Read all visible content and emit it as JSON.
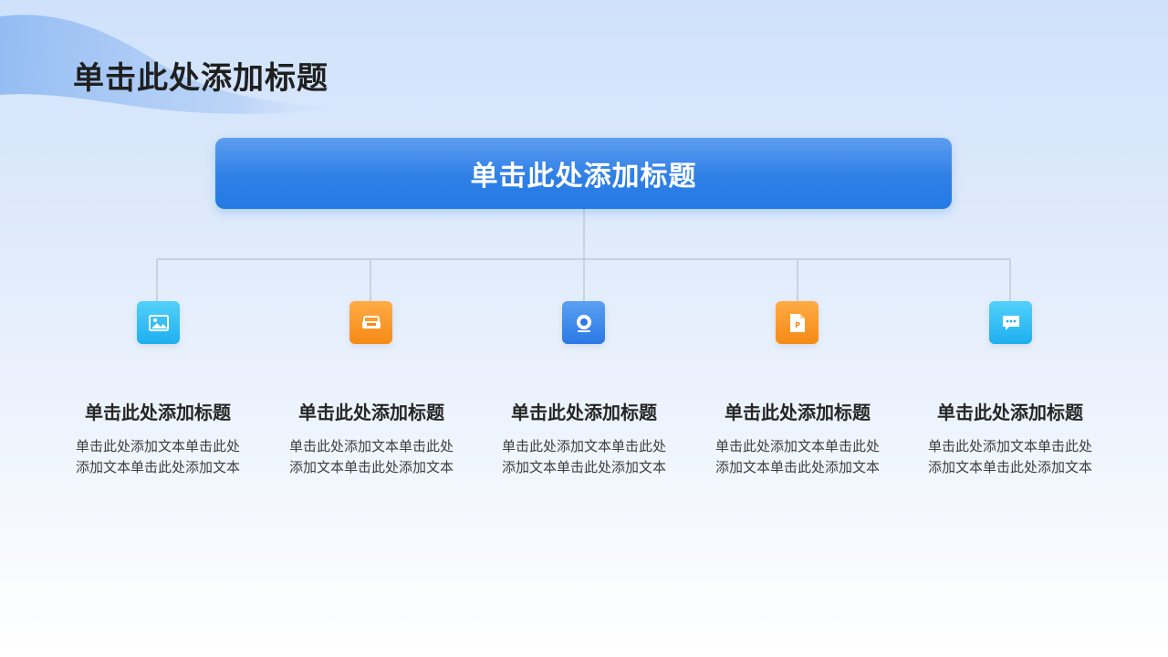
{
  "colors": {
    "main_box": "#2f7fe6",
    "title_text": "#1f1f1f",
    "connector": "#bfcbd8",
    "tile_cyan": "#1eaff0",
    "tile_orange": "#f58a16",
    "tile_blue": "#2a78e4"
  },
  "page": {
    "title": "单击此处添加标题"
  },
  "diagram": {
    "root": {
      "label": "单击此处添加标题"
    },
    "children": [
      {
        "icon": "image-icon",
        "tile_color": "cyan",
        "title": "单击此处添加标题",
        "text": "单击此处添加文本单击此处添加文本单击此处添加文本"
      },
      {
        "icon": "sofa-icon",
        "tile_color": "orange",
        "title": "单击此处添加标题",
        "text": "单击此处添加文本单击此处添加文本单击此处添加文本"
      },
      {
        "icon": "target-icon",
        "tile_color": "blue",
        "title": "单击此处添加标题",
        "text": "单击此处添加文本单击此处添加文本单击此处添加文本"
      },
      {
        "icon": "presentation-file-icon",
        "tile_color": "orange",
        "title": "单击此处添加标题",
        "text": "单击此处添加文本单击此处添加文本单击此处添加文本"
      },
      {
        "icon": "chat-bubble-icon",
        "tile_color": "cyan",
        "title": "单击此处添加标题",
        "text": "单击此处添加文本单击此处添加文本单击此处添加文本"
      }
    ]
  }
}
